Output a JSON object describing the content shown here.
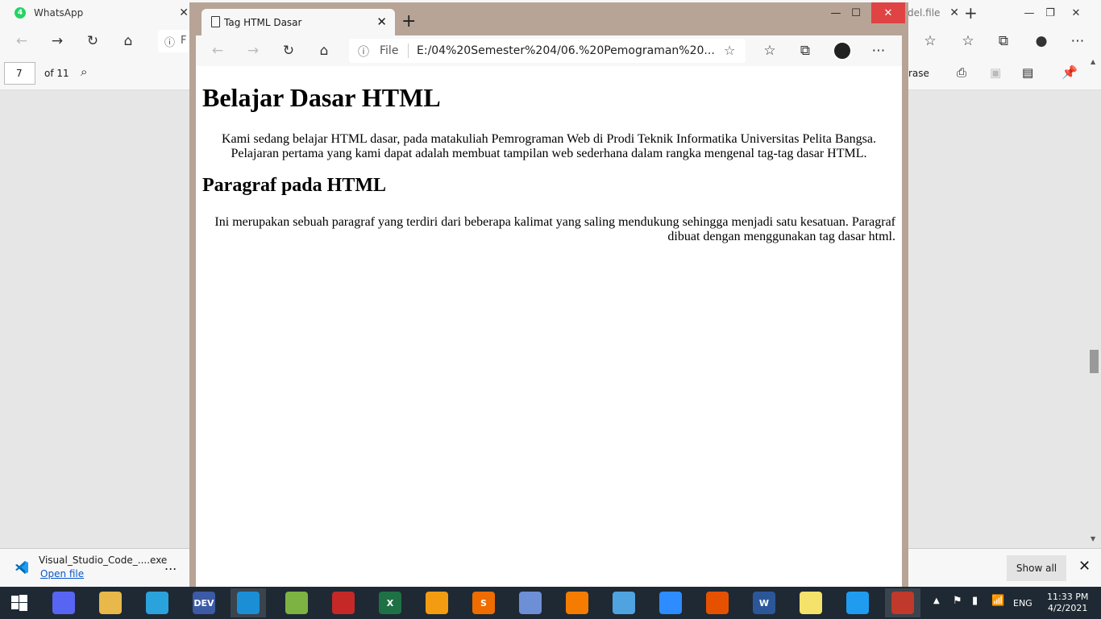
{
  "background_browser": {
    "tabs": [
      {
        "label": "WhatsApp",
        "badge": "4"
      },
      {
        "label": "del.file"
      }
    ],
    "pdf_toolbar": {
      "page_number": "7",
      "page_total": "of 11",
      "erase_label": "rase"
    },
    "url_fragment": "F"
  },
  "download_bar": {
    "filename": "Visual_Studio_Code_....exe",
    "open_link": "Open file",
    "more": "...",
    "show_all": "Show all"
  },
  "foreground_browser": {
    "tab_title": "Tag HTML Dasar",
    "url_scheme": "File",
    "url": "E:/04%20Semester%204/06.%20Pemograman%20..."
  },
  "page": {
    "heading1": "Belajar Dasar HTML",
    "paragraph1": "Kami sedang belajar HTML dasar, pada matakuliah Pemrograman Web di Prodi Teknik Informatika Universitas Pelita Bangsa. Pelajaran pertama yang kami dapat adalah membuat tampilan web sederhana dalam rangka mengenal tag-tag dasar HTML.",
    "heading2": "Paragraf pada HTML",
    "paragraph2": "Ini merupakan sebuah paragraf yang terdiri dari beberapa kalimat yang saling mendukung sehingga menjadi satu kesatuan. Paragraf dibuat dengan menggunakan tag dasar html."
  },
  "taskbar": {
    "apps": [
      {
        "name": "start",
        "color": "#1f2933",
        "text": ""
      },
      {
        "name": "discord",
        "color": "#5865f2",
        "text": ""
      },
      {
        "name": "file-explorer",
        "color": "#e8b84a",
        "text": ""
      },
      {
        "name": "telegram",
        "color": "#2aa3dc",
        "text": ""
      },
      {
        "name": "dev-cpp",
        "color": "#3c5aa6",
        "text": "DEV"
      },
      {
        "name": "edge",
        "color": "#1b8fd6",
        "text": ""
      },
      {
        "name": "notepad-plus",
        "color": "#7cb342",
        "text": ""
      },
      {
        "name": "acrobat",
        "color": "#c62828",
        "text": ""
      },
      {
        "name": "excel",
        "color": "#1e7145",
        "text": "X"
      },
      {
        "name": "media-player",
        "color": "#f39c12",
        "text": ""
      },
      {
        "name": "sublime",
        "color": "#ef6c00",
        "text": "S"
      },
      {
        "name": "paint",
        "color": "#6d8fd6",
        "text": ""
      },
      {
        "name": "xampp",
        "color": "#f57c00",
        "text": ""
      },
      {
        "name": "video-player",
        "color": "#4fa3e0",
        "text": ""
      },
      {
        "name": "zoom",
        "color": "#2d8cff",
        "text": ""
      },
      {
        "name": "matlab",
        "color": "#e65100",
        "text": ""
      },
      {
        "name": "word",
        "color": "#2b579a",
        "text": "W"
      },
      {
        "name": "sticky-notes",
        "color": "#f5e26b",
        "text": ""
      },
      {
        "name": "vscode",
        "color": "#1f9cf0",
        "text": ""
      },
      {
        "name": "snipping-tool",
        "color": "#c0392b",
        "text": ""
      }
    ],
    "language": "ENG",
    "time": "11:33 PM",
    "date": "4/2/2021"
  }
}
